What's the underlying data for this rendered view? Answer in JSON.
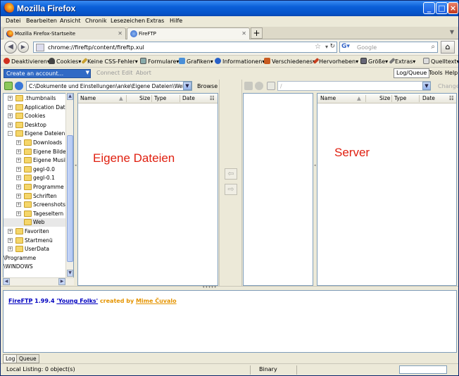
{
  "window": {
    "title": "Mozilla Firefox"
  },
  "menu": [
    "Datei",
    "Bearbeiten",
    "Ansicht",
    "Chronik",
    "Lesezeichen",
    "Extras",
    "Hilfe"
  ],
  "tabs": [
    {
      "label": "Mozilla Firefox-Startseite",
      "active": false
    },
    {
      "label": "FireFTP",
      "active": true
    }
  ],
  "nav": {
    "url": "chrome://fireftp/content/fireftp.xul",
    "search_placeholder": "Google"
  },
  "webdev": [
    "Deaktivieren",
    "Cookies",
    "Keine CSS-Fehler",
    "Formulare",
    "Grafiken",
    "Informationen",
    "Verschiedenes",
    "Hervorheben",
    "Größe",
    "Extras",
    "Quelltext"
  ],
  "ftp_toolbar": {
    "account": "Create an account...",
    "connect": "Connect",
    "edit": "Edit",
    "abort": "Abort",
    "logqueue": "Log/Queue",
    "tools": "Tools",
    "help": "Help"
  },
  "local": {
    "path": "C:\\Dokumente und Einstellungen\\anke\\Eigene Dateien\\Web",
    "browse": "Browse",
    "big_label": "Eigene Dateien",
    "tree": [
      {
        "label": ".thumbnails",
        "level": 1,
        "exp": "+"
      },
      {
        "label": "Application Data",
        "level": 1,
        "exp": "+"
      },
      {
        "label": "Cookies",
        "level": 1,
        "exp": "+"
      },
      {
        "label": "Desktop",
        "level": 1,
        "exp": "+"
      },
      {
        "label": "Eigene Dateien",
        "level": 1,
        "exp": "-"
      },
      {
        "label": "Downloads",
        "level": 2,
        "exp": "+"
      },
      {
        "label": "Eigene Bilder",
        "level": 2,
        "exp": "+"
      },
      {
        "label": "Eigene Musik",
        "level": 2,
        "exp": "+"
      },
      {
        "label": "gegl-0.0",
        "level": 2,
        "exp": "+"
      },
      {
        "label": "gegl-0.1",
        "level": 2,
        "exp": "+"
      },
      {
        "label": "Programme",
        "level": 2,
        "exp": "+"
      },
      {
        "label": "Schriften",
        "level": 2,
        "exp": "+"
      },
      {
        "label": "Screenshots",
        "level": 2,
        "exp": "+"
      },
      {
        "label": "Tageseltern",
        "level": 2,
        "exp": "+"
      },
      {
        "label": "Web",
        "level": 2,
        "exp": "",
        "selected": true
      },
      {
        "label": "Favoriten",
        "level": 1,
        "exp": "+"
      },
      {
        "label": "Startmenü",
        "level": 1,
        "exp": "+"
      },
      {
        "label": "UserData",
        "level": 1,
        "exp": "+"
      },
      {
        "label": "\\Programme",
        "level": 0,
        "exp": ""
      },
      {
        "label": "\\WINDOWS",
        "level": 0,
        "exp": ""
      }
    ]
  },
  "columns": {
    "name": "Name",
    "size": "Size",
    "type": "Type",
    "date": "Date"
  },
  "remote": {
    "path": "/",
    "change": "Change",
    "big_label": "Server"
  },
  "log": {
    "app": "FireFTP",
    "version": "1.99.4",
    "codename": "'Young Folks'",
    "created_by": "created by",
    "author": "Mime Čuvalo",
    "tabs": [
      "Log",
      "Queue"
    ]
  },
  "status": {
    "local_listing": "Local Listing: 0 object(s)",
    "mode": "Binary"
  }
}
